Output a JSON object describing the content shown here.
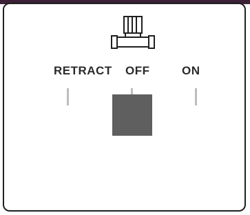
{
  "selector": {
    "positions": [
      {
        "label": "RETRACT"
      },
      {
        "label": "OFF"
      },
      {
        "label": "ON"
      }
    ],
    "selected": "OFF"
  },
  "colors": {
    "frame": "#1f1f1f",
    "top_strip": "#3b2037",
    "knob": "#5f5f5f",
    "tick": "#bdbdbd"
  },
  "icon": "pump-icon"
}
